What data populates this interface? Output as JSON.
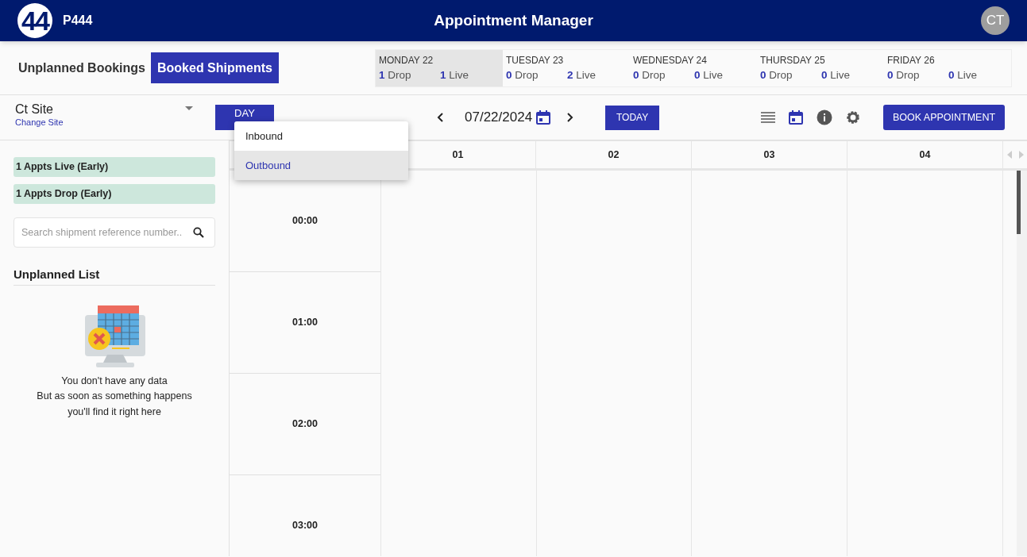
{
  "app_bar": {
    "logo": "44",
    "site_code": "P444",
    "title": "Appointment Manager",
    "avatar": "CT"
  },
  "tabs": [
    {
      "label": "Unplanned Bookings",
      "selected": false
    },
    {
      "label": "Booked Shipments",
      "selected": true
    }
  ],
  "week": [
    {
      "day": "MONDAY 22",
      "drop_count": "1",
      "drop_label": "Drop",
      "live_count": "1",
      "live_label": "Live",
      "selected": true
    },
    {
      "day": "TUESDAY 23",
      "drop_count": "0",
      "drop_label": "Drop",
      "live_count": "2",
      "live_label": "Live",
      "selected": false
    },
    {
      "day": "WEDNESDAY 24",
      "drop_count": "0",
      "drop_label": "Drop",
      "live_count": "0",
      "live_label": "Live",
      "selected": false
    },
    {
      "day": "THURSDAY 25",
      "drop_count": "0",
      "drop_label": "Drop",
      "live_count": "0",
      "live_label": "Live",
      "selected": false
    },
    {
      "day": "FRIDAY 26",
      "drop_count": "0",
      "drop_label": "Drop",
      "live_count": "0",
      "live_label": "Live",
      "selected": false
    }
  ],
  "toolbar": {
    "site": "Ct Site",
    "change_site": "Change Site",
    "view_button": "DAY",
    "date": "07/22/2024",
    "today_button": "TODAY",
    "book_button": "BOOK APPOINTMENT"
  },
  "direction_menu": [
    {
      "label": "Inbound",
      "selected": false
    },
    {
      "label": "Outbound",
      "selected": true
    }
  ],
  "sidebar": {
    "badges": [
      "1 Appts Live (Early)",
      "1 Appts Drop (Early)"
    ],
    "search": {
      "placeholder": "Search shipment reference number.."
    },
    "list_title": "Unplanned List",
    "empty_lines": [
      "You don't have any data",
      "But as soon as something happens",
      "you'll find it right here"
    ]
  },
  "calendar": {
    "columns": [
      "01",
      "02",
      "03",
      "04"
    ],
    "times": [
      "00:00",
      "01:00",
      "02:00",
      "03:00"
    ]
  }
}
